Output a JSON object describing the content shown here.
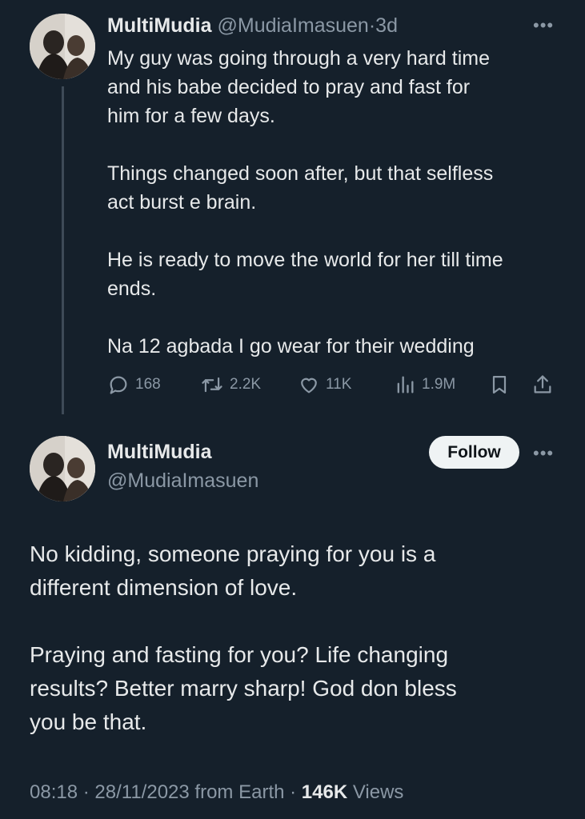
{
  "parent_tweet": {
    "display_name": "MultiMudia",
    "handle": "@MudiaImasuen",
    "separator": "·",
    "age": "3d",
    "more_icon": "more-horizontal-icon",
    "text": "My guy was going through a very hard time\nand his babe decided to pray and fast for\nhim for a few days.\n\nThings changed soon after, but that selfless\nact burst e brain.\n\nHe is ready to move the world for her till time\nends.\n\nNa 12 agbada I go wear for their wedding",
    "actions": {
      "replies": "168",
      "reposts": "2.2K",
      "likes": "11K",
      "views": "1.9M"
    }
  },
  "main_tweet": {
    "display_name": "MultiMudia",
    "handle": "@MudiaImasuen",
    "follow_label": "Follow",
    "text": "No kidding, someone praying for you is a\ndifferent dimension of love.\n\nPraying and fasting for you? Life changing\nresults? Better marry sharp! God don bless\nyou be that.",
    "meta": {
      "time": "08:18",
      "separator": "·",
      "date": "28/11/2023",
      "source": "from Earth",
      "views_count": "146K",
      "views_label": "Views"
    }
  },
  "colors": {
    "background": "#15202b",
    "text": "#e7e9ea",
    "muted": "#8b98a5",
    "follow_bg": "#eff3f4"
  }
}
